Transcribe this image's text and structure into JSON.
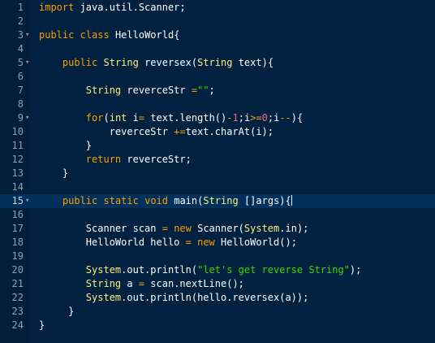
{
  "colors": {
    "background": "#002240",
    "gutter": "#011e3a",
    "active_line": "#01315a",
    "keyword": "#ff9d00",
    "type": "#ffee80",
    "string": "#3ad900",
    "number": "#ff628c",
    "plain": "#ffffff"
  },
  "editor": {
    "active_line": 15,
    "lines": [
      {
        "n": "1",
        "fold": false,
        "tokens": [
          [
            "kw",
            "import"
          ],
          [
            "plain",
            " java.util.Scanner;"
          ]
        ]
      },
      {
        "n": "2",
        "fold": false,
        "tokens": []
      },
      {
        "n": "3",
        "fold": true,
        "tokens": [
          [
            "kw",
            "public"
          ],
          [
            "plain",
            " "
          ],
          [
            "kw",
            "class"
          ],
          [
            "plain",
            " HelloWorld{"
          ]
        ]
      },
      {
        "n": "4",
        "fold": false,
        "tokens": []
      },
      {
        "n": "5",
        "fold": true,
        "tokens": [
          [
            "plain",
            "    "
          ],
          [
            "kw",
            "public"
          ],
          [
            "plain",
            " "
          ],
          [
            "ty",
            "String"
          ],
          [
            "plain",
            " reversex("
          ],
          [
            "ty",
            "String"
          ],
          [
            "plain",
            " text){"
          ]
        ]
      },
      {
        "n": "6",
        "fold": false,
        "tokens": []
      },
      {
        "n": "7",
        "fold": false,
        "tokens": [
          [
            "plain",
            "        "
          ],
          [
            "ty",
            "String"
          ],
          [
            "plain",
            " reverceStr "
          ],
          [
            "op",
            "="
          ],
          [
            "st",
            "\"\""
          ],
          [
            "plain",
            ";"
          ]
        ]
      },
      {
        "n": "8",
        "fold": false,
        "tokens": []
      },
      {
        "n": "9",
        "fold": true,
        "tokens": [
          [
            "plain",
            "        "
          ],
          [
            "kw",
            "for"
          ],
          [
            "plain",
            "("
          ],
          [
            "ty",
            "int"
          ],
          [
            "plain",
            " i"
          ],
          [
            "op",
            "="
          ],
          [
            "plain",
            " text.length()"
          ],
          [
            "op",
            "-"
          ],
          [
            "nu",
            "1"
          ],
          [
            "plain",
            ";i"
          ],
          [
            "op",
            ">="
          ],
          [
            "nu",
            "0"
          ],
          [
            "plain",
            ";i"
          ],
          [
            "op",
            "--"
          ],
          [
            "plain",
            "){"
          ]
        ]
      },
      {
        "n": "10",
        "fold": false,
        "tokens": [
          [
            "plain",
            "            reverceStr "
          ],
          [
            "op",
            "+="
          ],
          [
            "plain",
            "text.charAt(i);"
          ]
        ]
      },
      {
        "n": "11",
        "fold": false,
        "tokens": [
          [
            "plain",
            "        }"
          ]
        ]
      },
      {
        "n": "12",
        "fold": false,
        "tokens": [
          [
            "plain",
            "        "
          ],
          [
            "kw",
            "return"
          ],
          [
            "plain",
            " reverceStr;"
          ]
        ]
      },
      {
        "n": "13",
        "fold": false,
        "tokens": [
          [
            "plain",
            "    }"
          ]
        ]
      },
      {
        "n": "14",
        "fold": false,
        "tokens": []
      },
      {
        "n": "15",
        "fold": true,
        "tokens": [
          [
            "plain",
            "    "
          ],
          [
            "kw",
            "public"
          ],
          [
            "plain",
            " "
          ],
          [
            "kw",
            "static"
          ],
          [
            "plain",
            " "
          ],
          [
            "kw",
            "void"
          ],
          [
            "plain",
            " main("
          ],
          [
            "ty",
            "String"
          ],
          [
            "plain",
            " []args){"
          ]
        ]
      },
      {
        "n": "16",
        "fold": false,
        "tokens": []
      },
      {
        "n": "17",
        "fold": false,
        "tokens": [
          [
            "plain",
            "        Scanner scan "
          ],
          [
            "op",
            "="
          ],
          [
            "plain",
            " "
          ],
          [
            "kw",
            "new"
          ],
          [
            "plain",
            " Scanner("
          ],
          [
            "ty",
            "System"
          ],
          [
            "plain",
            ".in);"
          ]
        ]
      },
      {
        "n": "18",
        "fold": false,
        "tokens": [
          [
            "plain",
            "        HelloWorld hello "
          ],
          [
            "op",
            "="
          ],
          [
            "plain",
            " "
          ],
          [
            "kw",
            "new"
          ],
          [
            "plain",
            " HelloWorld();"
          ]
        ]
      },
      {
        "n": "19",
        "fold": false,
        "tokens": []
      },
      {
        "n": "20",
        "fold": false,
        "tokens": [
          [
            "plain",
            "        "
          ],
          [
            "ty",
            "System"
          ],
          [
            "plain",
            ".out.println("
          ],
          [
            "st",
            "\"let's get reverse String\""
          ],
          [
            "plain",
            ");"
          ]
        ]
      },
      {
        "n": "21",
        "fold": false,
        "tokens": [
          [
            "plain",
            "        "
          ],
          [
            "ty",
            "String"
          ],
          [
            "plain",
            " a "
          ],
          [
            "op",
            "="
          ],
          [
            "plain",
            " scan.nextLine();"
          ]
        ]
      },
      {
        "n": "22",
        "fold": false,
        "tokens": [
          [
            "plain",
            "        "
          ],
          [
            "ty",
            "System"
          ],
          [
            "plain",
            ".out.println(hello.reversex(a));"
          ]
        ]
      },
      {
        "n": "23",
        "fold": false,
        "tokens": [
          [
            "plain",
            "     "
          ],
          [
            "plain",
            "}"
          ]
        ]
      },
      {
        "n": "24",
        "fold": false,
        "tokens": [
          [
            "plain",
            "}"
          ]
        ]
      }
    ]
  }
}
